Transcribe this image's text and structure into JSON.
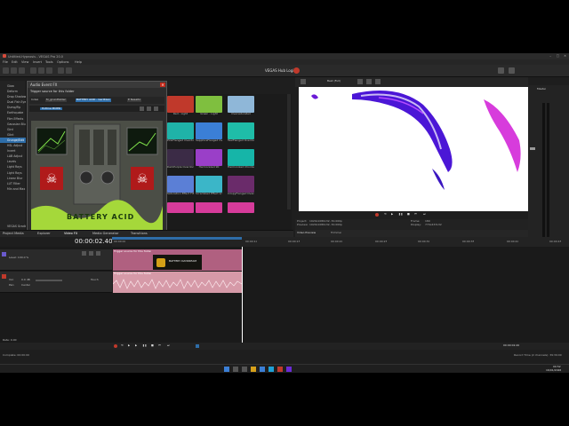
{
  "app": {
    "title": "Untitled-Hypnosis - VEGAS Pro 20.0",
    "login_label": "VEGAS Hub Login"
  },
  "menu": [
    "File",
    "Edit",
    "View",
    "Insert",
    "Tools",
    "Options",
    "Help"
  ],
  "fx_list": {
    "items": [
      "Glow",
      "Deform",
      "Drop Shadow",
      "Dual Fish Eye",
      "Dump/Fip",
      "Earthquake",
      "Film Effects",
      "Gaussian Blur",
      "Gird",
      "Glint",
      "Grunge/Edit",
      "HSL Adjust",
      "Invert",
      "LAB Adjust",
      "Levels",
      "Light Rays",
      "Light Rays",
      "Linear Blur",
      "LUT Filter",
      "Min and Max"
    ],
    "selected_index": 10,
    "footer": "VEGAS Gradient"
  },
  "dialog": {
    "title": "Audio Event FX",
    "preset_label": "Trigger source for this folder",
    "tab_labels": [
      "Index",
      "fx_grundfelder",
      "BATTERY ACID - Gerlitzen",
      "E Nasalto"
    ],
    "track_label": "Hotline MIXER"
  },
  "plugin": {
    "name": "BATTERY ACID",
    "footer_text": "LEADING-ORANGERUNE - ACID FX - GRUNGE-RESONANCE FLO"
  },
  "thumbnails": [
    {
      "caption": "Red - Light",
      "color": "#c0392b"
    },
    {
      "caption": "Green - Light",
      "color": "#7fbf3f"
    },
    {
      "caption": "Oversaturated",
      "color": "#8fb7d8"
    },
    {
      "caption": "PinkFlanged\nOverdone",
      "color": "#1fb3a8"
    },
    {
      "caption": "SapphireFlanged\nOverdone",
      "color": "#3b7fd6"
    },
    {
      "caption": "TealFlanged\nOverdone",
      "color": "#1fbda8"
    },
    {
      "caption": "DarkPurple\nOverdone",
      "color": "#3b2b46"
    },
    {
      "caption": "Harmonized 90",
      "color": "#9a3fc8"
    },
    {
      "caption": "Harmonized Chorded",
      "color": "#16b5a8"
    },
    {
      "caption": "Saturation Effect\nFINAL",
      "color": "#5b7fd6"
    },
    {
      "caption": "Scrambled Effect\n2/13",
      "color": "#3bb6c8"
    },
    {
      "caption": "CrispyFlanged\nOverdone",
      "color": "#6a2b6a"
    },
    {
      "caption": "",
      "color": "#d63b9a"
    },
    {
      "caption": "",
      "color": "#d63b9a"
    },
    {
      "caption": "",
      "color": "#d63b9a"
    }
  ],
  "preview": {
    "project_label": "Project:",
    "project_value": "1920x1080x32, 30.000p",
    "preview_label": "Preview:",
    "preview_value": "1920x1080x32, 30.000p",
    "display_label": "Display:",
    "display_value": "770x433x32",
    "frame_label": "Frame:",
    "frame_value": "180",
    "quality": "Best (Full)",
    "tab_video": "Video Preview",
    "tab_trimmer": "Trimmer"
  },
  "master": {
    "label": "Master",
    "bus_label": "Master Bus"
  },
  "bottom_tabs": [
    "Project Media",
    "Explorer",
    "Video FX",
    "Media Generator",
    "Transitions"
  ],
  "timeline": {
    "timecode": "00:00:02.40",
    "ruler": [
      "00:00:00",
      "00:00:10",
      "00:00:15",
      "00:00:20",
      "00:00:25",
      "00:00:30",
      "00:00:35",
      "00:00:40",
      "00:00:45",
      "00:00:50"
    ],
    "video_track_label": "Level: 100.0 %",
    "audio_vol_label": "Vol:",
    "audio_vol_value": "0.0 dB",
    "audio_pan_label": "Pan:",
    "audio_pan_value": "Center",
    "audio_touch": "Touch",
    "clip_title": "Trigger source for this folder",
    "clip_logo": "BATTERY DAYDREAM"
  },
  "transport": {
    "rate": "Rate: 0.00",
    "end_time": "00:00:02.40"
  },
  "status": {
    "left": "Complete: 00:00:00",
    "right": "Record Time (2 channels): 39:39:00"
  },
  "taskbar": {
    "time": "00:52",
    "date": "16/01/2026"
  }
}
